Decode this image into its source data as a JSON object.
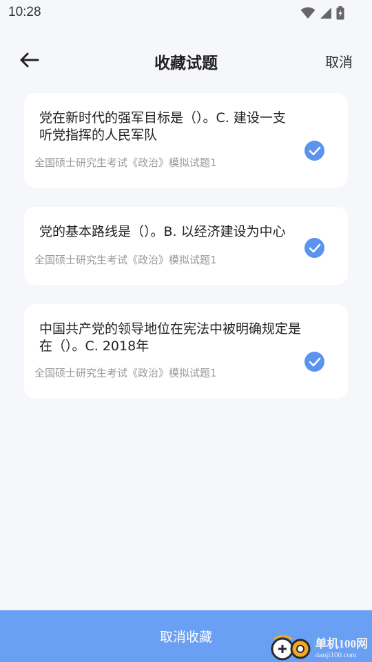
{
  "status": {
    "time": "10:28"
  },
  "header": {
    "title": "收藏试题",
    "cancel_label": "取消"
  },
  "questions": [
    {
      "text": "党在新时代的强军目标是（）。C. 建设一支\n听党指挥的人民军队",
      "source": "全国硕士研究生考试《政治》模拟试题1",
      "checked": true
    },
    {
      "text": "党的基本路线是（）。B. 以经济建设为中心",
      "source": "全国硕士研究生考试《政治》模拟试题1",
      "checked": true
    },
    {
      "text": "中国共产党的领导地位在宪法中被明确规定是\n在（）。C. 2018年",
      "source": "全国硕士研究生考试《政治》模拟试题1",
      "checked": true
    }
  ],
  "footer": {
    "button_label": "取消收藏"
  },
  "watermark": {
    "cn": "单机100网",
    "en": "danji100.com"
  },
  "colors": {
    "accent": "#6aa0f4",
    "check": "#5b93ef",
    "background": "#f6f7fb"
  }
}
